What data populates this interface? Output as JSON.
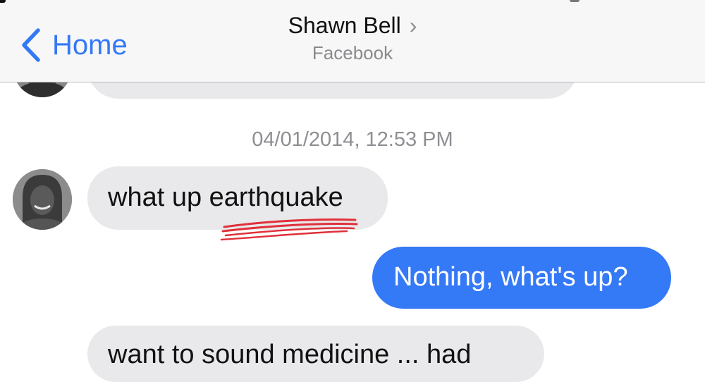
{
  "nav": {
    "back_label": "Home",
    "contact_name": "Shawn Bell",
    "contact_chevron": "›",
    "contact_source": "Facebook"
  },
  "thread": {
    "timestamp": "04/01/2014, 12:53 PM",
    "messages": [
      {
        "direction": "incoming",
        "text": "what up earthquake",
        "annotation": "red-scribble-underline"
      },
      {
        "direction": "outgoing",
        "text": "Nothing, what's up?"
      },
      {
        "direction": "incoming",
        "text": "want to sound medicine ... had"
      }
    ]
  },
  "colors": {
    "accent": "#3478f6",
    "outgoing_bubble": "#3479f6",
    "incoming_bubble": "#e9e9eb",
    "annotation_red": "#e0303a"
  },
  "icons": {
    "back": "chevron-left-icon",
    "contact_detail": "chevron-right-icon"
  }
}
